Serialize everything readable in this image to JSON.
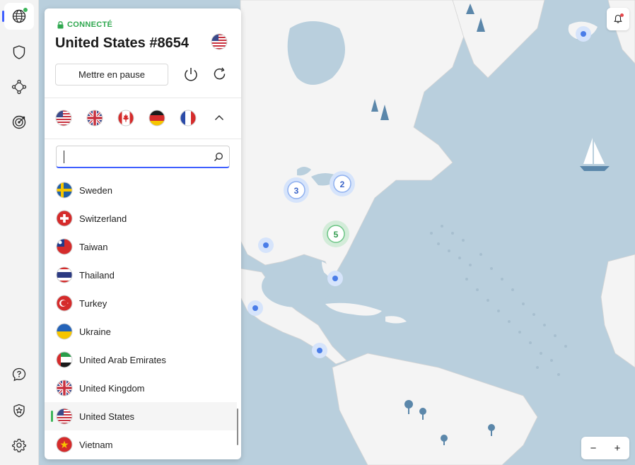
{
  "app": {
    "connection_status": "CONNECTÉ",
    "server_name": "United States #8654",
    "status_color": "#3cb55a",
    "accent_color": "#3e5fff"
  },
  "rail": {
    "items": [
      {
        "icon": "globe-icon",
        "active": true
      },
      {
        "icon": "shield-icon"
      },
      {
        "icon": "meshnet-icon"
      },
      {
        "icon": "target-icon"
      }
    ],
    "bottom_items": [
      {
        "icon": "help-icon"
      },
      {
        "icon": "star-shield-icon"
      },
      {
        "icon": "settings-icon"
      }
    ]
  },
  "controls": {
    "pause_label": "Mettre en pause",
    "power_icon": "power-icon",
    "refresh_icon": "refresh-icon"
  },
  "quick_connect": {
    "flags": [
      "us",
      "gb",
      "ca",
      "de",
      "fr"
    ],
    "collapse_icon": "chevron-up-icon"
  },
  "search": {
    "value": "",
    "placeholder": "",
    "icon": "search-icon"
  },
  "countries": [
    {
      "name": "Sweden",
      "flag": "se"
    },
    {
      "name": "Switzerland",
      "flag": "ch"
    },
    {
      "name": "Taiwan",
      "flag": "tw"
    },
    {
      "name": "Thailand",
      "flag": "th"
    },
    {
      "name": "Turkey",
      "flag": "tr"
    },
    {
      "name": "Ukraine",
      "flag": "ua"
    },
    {
      "name": "United Arab Emirates",
      "flag": "ae"
    },
    {
      "name": "United Kingdom",
      "flag": "gb"
    },
    {
      "name": "United States",
      "flag": "us",
      "selected": true
    },
    {
      "name": "Vietnam",
      "flag": "vn"
    }
  ],
  "map": {
    "clusters": [
      {
        "label": "3"
      },
      {
        "label": "2"
      },
      {
        "label": "5",
        "connected": true
      }
    ],
    "zoom_out": "−",
    "zoom_in": "+"
  }
}
